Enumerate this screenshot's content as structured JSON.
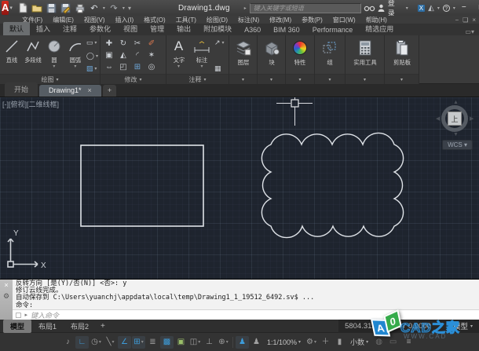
{
  "window": {
    "title": "Drawing1.dwg",
    "search_placeholder": "键入关键字或短语",
    "sign_in_label": "登录",
    "min": "−",
    "max": "□",
    "close": "×"
  },
  "menu": {
    "items": [
      "文件(F)",
      "编辑(E)",
      "视图(V)",
      "插入(I)",
      "格式(O)",
      "工具(T)",
      "绘图(D)",
      "标注(N)",
      "修改(M)",
      "参数(P)",
      "窗口(W)",
      "帮助(H)"
    ],
    "doc_min": "−",
    "doc_restore": "❏",
    "doc_close": "×"
  },
  "ribbon": {
    "tabs": [
      "默认",
      "插入",
      "注释",
      "参数化",
      "视图",
      "管理",
      "输出",
      "附加模块",
      "A360",
      "BIM 360",
      "Performance",
      "精选应用"
    ],
    "draw": {
      "title": "绘图",
      "line": "直线",
      "polyline": "多段线",
      "circle": "圆",
      "arc": "圆弧",
      "rect_glyph": "▭",
      "ellipse_glyph": "◯",
      "hatch_glyph": "▨"
    },
    "modify": {
      "title": "修改",
      "icons": [
        {
          "name": "move",
          "glyph": "✚"
        },
        {
          "name": "rotate",
          "glyph": "↻"
        },
        {
          "name": "trim",
          "glyph": "✂"
        },
        {
          "name": "erase",
          "glyph": "✐"
        },
        {
          "name": "copy",
          "glyph": "▣"
        },
        {
          "name": "mirror",
          "glyph": "◭"
        },
        {
          "name": "fillet",
          "glyph": "◜"
        },
        {
          "name": "explode",
          "glyph": "✶"
        },
        {
          "name": "stretch",
          "glyph": "⇔"
        },
        {
          "name": "scale",
          "glyph": "◰"
        },
        {
          "name": "array",
          "glyph": "⊞"
        },
        {
          "name": "offset",
          "glyph": "◎"
        }
      ]
    },
    "annotate": {
      "title": "注释",
      "text": "文字",
      "text_glyph": "A",
      "dimension": "标注",
      "leader_glyph": "↗",
      "table_glyph": "▦"
    },
    "layers": {
      "label": "图层"
    },
    "block": {
      "label": "块"
    },
    "properties": {
      "label": "特性"
    },
    "group": {
      "label": "组",
      "glyph": "⁛"
    },
    "utilities": {
      "label": "实用工具"
    },
    "clipboard": {
      "label": "剪贴板"
    }
  },
  "file_tabs": {
    "start": "开始",
    "drawing": "Drawing1*",
    "close": "×",
    "new": "+"
  },
  "canvas": {
    "viewport_label": "[-][俯视][二维线框]",
    "viewcube_face": "上",
    "wcs_label": "WCS ▾",
    "ucs_x": "X",
    "ucs_y": "Y"
  },
  "command": {
    "line1": "反转方向 [是(Y)/否(N)] <否>: y",
    "line2": "修订云线完成。",
    "line3": "自动保存到 C:\\Users\\yuanchj\\appdata\\local\\temp\\Drawing1_1_19512_6492.sv$ ...",
    "line4": "命令:",
    "close": "×",
    "placeholder": "键入命令",
    "input_icon": "▢"
  },
  "layout_tabs": {
    "model": "模型",
    "layout1": "布局1",
    "layout2": "布局2",
    "new": "+"
  },
  "status_row1": {
    "coords_a": "5804.312",
    "coords_b": "67 0.0000",
    "model_space": "模型"
  },
  "status": {
    "toggles": [
      {
        "name": "snap-mode",
        "glyph": "♪"
      },
      {
        "name": "ortho-mode",
        "glyph": "∟"
      },
      {
        "name": "polar-tracking",
        "glyph": "◷"
      },
      {
        "name": "isodraft",
        "glyph": "╲"
      },
      {
        "name": "osnap-tracking",
        "glyph": "∠"
      },
      {
        "name": "object-snap",
        "glyph": "⊞"
      },
      {
        "name": "lineweight",
        "glyph": "≣"
      },
      {
        "name": "transparency",
        "glyph": "▩"
      },
      {
        "name": "selection-cycling",
        "glyph": "▣"
      },
      {
        "name": "3d-osnap",
        "glyph": "◫"
      },
      {
        "name": "dynamic-ucs",
        "glyph": "⊥"
      },
      {
        "name": "dynamic-input",
        "glyph": "⊕"
      },
      {
        "name": "annotation-visibility",
        "glyph": "♟"
      },
      {
        "name": "autoscale",
        "glyph": "♟"
      }
    ],
    "scale": "1:1/100%",
    "gear_glyph": "⚙",
    "monitor_glyph": "＋",
    "isolate_glyph": "▮",
    "units": "小数",
    "perf_glyph": "◍",
    "clean_glyph": "▭",
    "customize_glyph": "≡"
  },
  "watermark": {
    "title": "CAD之家",
    "subtitle": "WWW.CAD",
    "cube_a": "A",
    "cube_o": "0"
  },
  "colors": {
    "accent_blue": "#3d9bd8",
    "logo_red": "#c8252c",
    "canvas_bg": "#1e242e"
  }
}
